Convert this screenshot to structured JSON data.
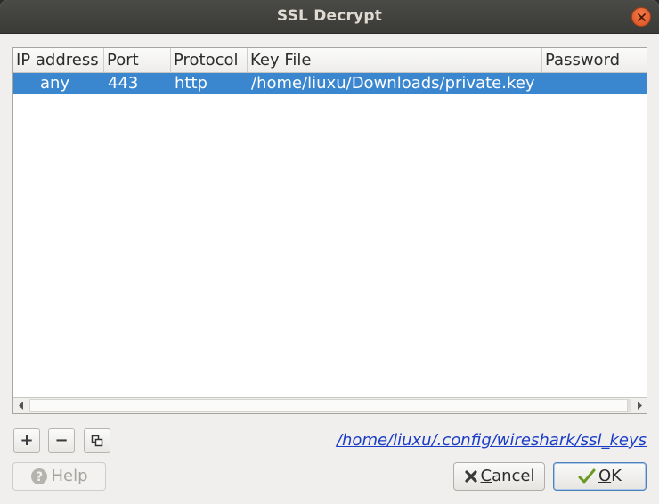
{
  "window": {
    "title": "SSL Decrypt"
  },
  "table": {
    "columns": [
      "IP address",
      "Port",
      "Protocol",
      "Key File",
      "Password"
    ],
    "rows": [
      {
        "ip": "any",
        "port": "443",
        "protocol": "http",
        "key_file": "/home/liuxu/Downloads/private.key",
        "password": ""
      }
    ],
    "selected_row": 0
  },
  "toolbar": {
    "add_label": "+",
    "remove_label": "−",
    "copy_icon": "copy-icon"
  },
  "config_path": "/home/liuxu/.config/wireshark/ssl_keys",
  "buttons": {
    "help_label": "Help",
    "cancel_label": "Cancel",
    "ok_label": "OK"
  },
  "colors": {
    "selection": "#3a86cf",
    "link": "#1a3dc7",
    "close": "#e05a28"
  }
}
